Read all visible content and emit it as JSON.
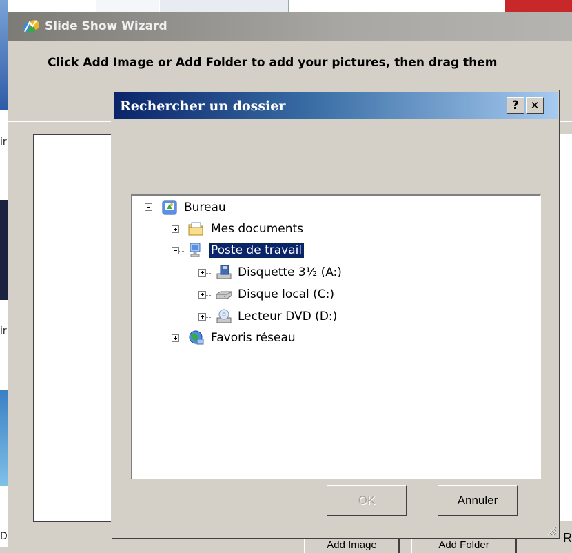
{
  "wizard": {
    "title": "Slide Show Wizard",
    "instruction": "Click Add Image or Add Folder to add your pictures, then drag them",
    "buttons": {
      "add_image": "Add Image",
      "add_folder": "Add Folder",
      "partial_right": "R"
    },
    "left_edge_letters": [
      "ir",
      "ir",
      "D"
    ]
  },
  "dialog": {
    "title": "Rechercher un dossier",
    "help_button": "?",
    "close_button": "✕",
    "tree": {
      "root": "Bureau",
      "items": [
        {
          "label": "Mes documents",
          "icon": "my-documents-icon"
        },
        {
          "label": "Poste de travail",
          "icon": "my-computer-icon",
          "selected": true,
          "children": [
            {
              "label": "Disquette 3½ (A:)",
              "icon": "floppy-drive-icon"
            },
            {
              "label": "Disque local (C:)",
              "icon": "hard-disk-icon"
            },
            {
              "label": "Lecteur DVD (D:)",
              "icon": "dvd-drive-icon"
            }
          ]
        },
        {
          "label": "Favoris réseau",
          "icon": "network-places-icon"
        }
      ]
    },
    "ok_label": "OK",
    "cancel_label": "Annuler"
  },
  "colors": {
    "dialog_title_start": "#0a246a",
    "dialog_title_end": "#a6caf0",
    "selection": "#0a246a",
    "face": "#d4d0c8"
  }
}
